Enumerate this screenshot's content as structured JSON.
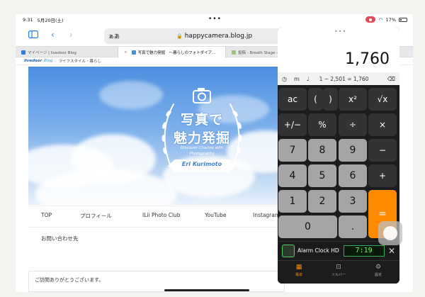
{
  "status": {
    "time": "9:31",
    "date": "5月20日(土)",
    "battery": "17%"
  },
  "browser": {
    "aa": "ぁあ",
    "url": "happycamera.blog.jp",
    "tabs": [
      {
        "label": "マイページ | livedoor Blog",
        "color": "#2a7de1"
      },
      {
        "label": "写真で魅力発掘　〜暮らしのフォトダイア…",
        "color": "#4a90d9"
      },
      {
        "label": "投稿 - Breath Stage — W",
        "color": "#9bc37a"
      }
    ]
  },
  "site": {
    "brand": "livedoor",
    "brand2": "Blog",
    "category": "ライフスタイル・暮らし"
  },
  "hero": {
    "title_line1": "写真で",
    "title_line2": "魅力発掘",
    "subtitle1": "Discover Charms with",
    "subtitle2": "Photography",
    "ribbon": "Eri Kurimoto"
  },
  "nav": {
    "items": [
      "TOP",
      "プロフィール",
      "ILii Photo Club",
      "YouTube",
      "Instagram"
    ],
    "contact": "お問い合わせ先"
  },
  "notice": "ご訪問ありがとうございます。",
  "calc": {
    "display": "1,760",
    "history": "1 − 2,501 = 1,760",
    "hist_m": "m",
    "keys": [
      [
        "ac",
        "(",
        ")",
        "x²",
        "√x"
      ],
      [
        "+/−",
        "%",
        "÷",
        "×"
      ],
      [
        "7",
        "8",
        "9",
        "−"
      ],
      [
        "4",
        "5",
        "6",
        "+"
      ],
      [
        "1",
        "2",
        "3",
        "="
      ],
      [
        "0",
        "."
      ]
    ],
    "ad": {
      "title": "Alarm Clock HD",
      "clock": "7:19"
    },
    "tabs": [
      "電卓",
      "ソルバー",
      "設定"
    ]
  }
}
